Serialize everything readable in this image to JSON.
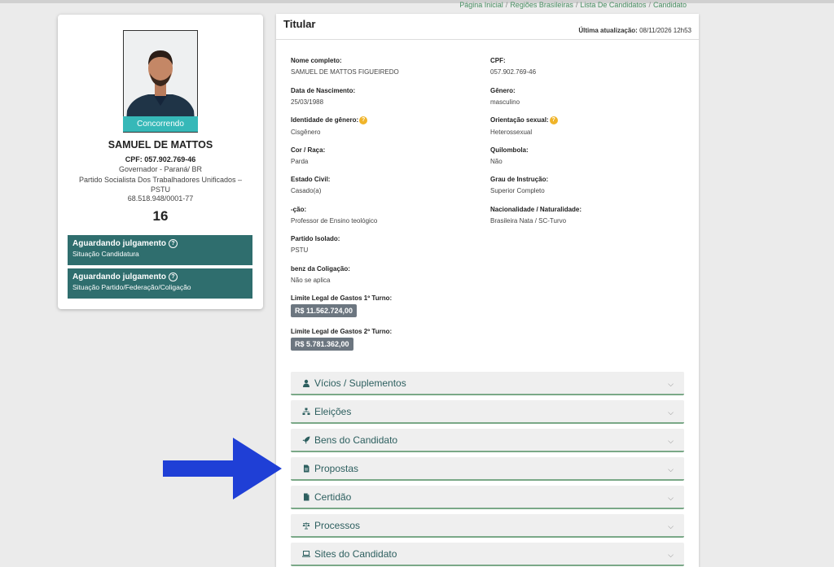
{
  "breadcrumb": {
    "items": [
      "Página Inicial",
      "Regiões Brasileiras",
      "Lista De Candidatos",
      "Candidato"
    ],
    "separator": "/"
  },
  "candidate_card": {
    "photo_badge": "Concorrendo",
    "name": "SAMUEL DE MATTOS",
    "cpf": "CPF: 057.902.769-46",
    "office": "Governador - Paraná/ BR",
    "party": "Partido Socialista Dos Trabalhadores Unificados – PSTU",
    "cnpj": "68.518.948/0001-77",
    "number": "16",
    "statuses": [
      {
        "title": "Aguardando julgamento",
        "subtitle": "Situação Candidatura"
      },
      {
        "title": "Aguardando julgamento",
        "subtitle": "Situação Partido/Federação/Coligação"
      }
    ]
  },
  "panel": {
    "title": "Titular",
    "updated_label": "Última atualização:",
    "updated_value": "08/11/2026 12h53",
    "fields_left": [
      {
        "label": "Nome completo:",
        "value": "SAMUEL DE MATTOS FIGUEIREDO"
      },
      {
        "label": "Data de Nascimento:",
        "value": "25/03/1988"
      },
      {
        "label": "Identidade de gênero:",
        "value": "Cisgênero",
        "help": true
      },
      {
        "label": "Cor / Raça:",
        "value": "Parda"
      },
      {
        "label": "Estado Civil:",
        "value": "Casado(a)"
      },
      {
        "label": "-ção:",
        "value": "Professor de Ensino teológico"
      },
      {
        "label": "Partido Isolado:",
        "value": "PSTU"
      },
      {
        "label": "benz da Coligação:",
        "value": "Não se aplica"
      },
      {
        "label": "Limite Legal de Gastos 1º Turno:",
        "value": "R$ 11.562.724,00"
      },
      {
        "label": "Limite Legal de Gastos 2º Turno:",
        "value": "R$ 5.781.362,00"
      }
    ],
    "fields_right": [
      {
        "label": "CPF:",
        "value": "057.902.769-46"
      },
      {
        "label": "Gênero:",
        "value": "masculino"
      },
      {
        "label": "Orientação sexual:",
        "value": "Heterossexual",
        "help": true
      },
      {
        "label": "Quilombola:",
        "value": "Não"
      },
      {
        "label": "Grau de Instrução:",
        "value": "Superior Completo"
      },
      {
        "label": "Nacionalidade / Naturalidade:",
        "value": "Brasileira Nata / SC-Turvo"
      }
    ],
    "help_glyph": "?",
    "accordions": [
      {
        "label": "Vícios / Suplementos",
        "icon": "user-icon"
      },
      {
        "label": "Eleições",
        "icon": "sitemap-icon"
      },
      {
        "label": "Bens do Candidato",
        "icon": "rocket-icon"
      },
      {
        "label": "Propostas",
        "icon": "file-icon"
      },
      {
        "label": "Certidão",
        "icon": "document-icon"
      },
      {
        "label": "Processos",
        "icon": "scale-icon"
      },
      {
        "label": "Sites do Candidato",
        "icon": "laptop-icon"
      }
    ],
    "chevron_glyph": "⌵"
  },
  "colors": {
    "status_bg": "#2f6e6e",
    "badge_bg": "#36b8b8",
    "accordion_label": "#2d5f5f",
    "accordion_border": "#7aa887",
    "arrow": "#1f3fd6",
    "help_icon": "#f0b429",
    "breadcrumb": "#4a8f63"
  }
}
